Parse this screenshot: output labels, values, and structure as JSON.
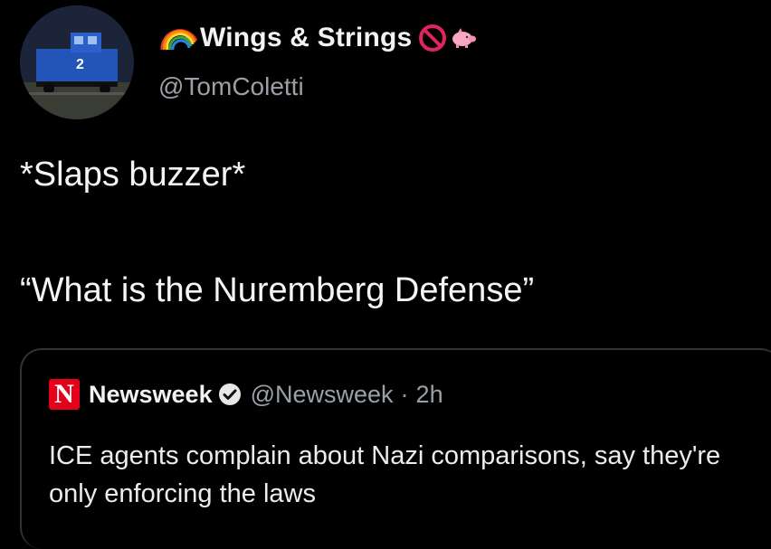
{
  "tweet": {
    "display_name": "Wings & Strings",
    "handle": "@TomColetti",
    "lines": [
      "*Slaps buzzer*",
      "“What is the Nuremberg Defense”"
    ]
  },
  "quote": {
    "name": "Newsweek",
    "logo_letter": "N",
    "handle": "@Newsweek",
    "separator": "·",
    "time": "2h",
    "text": "ICE agents complain about Nazi comparisons, say they're only enforcing the laws"
  },
  "icons": {
    "rainbow": "rainbow-icon",
    "no_symbol": "no-symbol-icon",
    "pig": "pig-icon",
    "verified": "verified-badge-icon"
  },
  "colors": {
    "background": "#000000",
    "text": "#f5f5f5",
    "muted": "#9aa0a6",
    "newsweek_red": "#e4021b",
    "no_symbol_red": "#e0245e",
    "pig_pink": "#f7a8c0"
  }
}
